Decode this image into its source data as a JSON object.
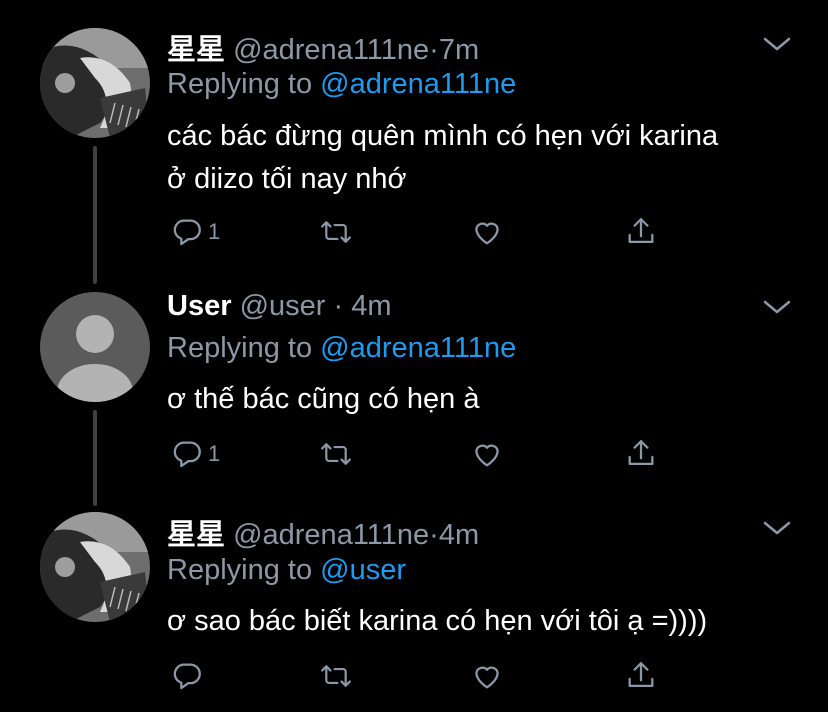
{
  "colors": {
    "background": "#000000",
    "secondary_text": "#8b98a5",
    "mention": "#1d9bf0",
    "thread_line": "#3d4144"
  },
  "tweets": [
    {
      "name": "星星",
      "handle": "@adrena111ne",
      "separator": "·",
      "time": "7m",
      "replying_prefix": "Replying to ",
      "replying_to": "@adrena111ne",
      "text_line1": "các bác đừng quên mình có hẹn với karina",
      "text_line2": "ở diizo tối nay nhớ",
      "reply_count": "1",
      "avatar": "photo-avatar"
    },
    {
      "name": "User",
      "handle": "@user",
      "separator": "·",
      "time": "4m",
      "replying_prefix": "Replying to ",
      "replying_to": "@adrena111ne",
      "text_line1": "ơ thế bác cũng có hẹn à",
      "reply_count": "1",
      "avatar": "default-avatar"
    },
    {
      "name": "星星",
      "handle": "@adrena111ne",
      "separator": "·",
      "time": "4m",
      "replying_prefix": "Replying to ",
      "replying_to": "@user",
      "text_line1": "ơ sao bác biết karina có hẹn với tôi ạ =))))",
      "reply_count": "",
      "avatar": "photo-avatar"
    }
  ],
  "icons": [
    "reply-icon",
    "retweet-icon",
    "like-icon",
    "share-icon",
    "chevron-down-icon"
  ]
}
